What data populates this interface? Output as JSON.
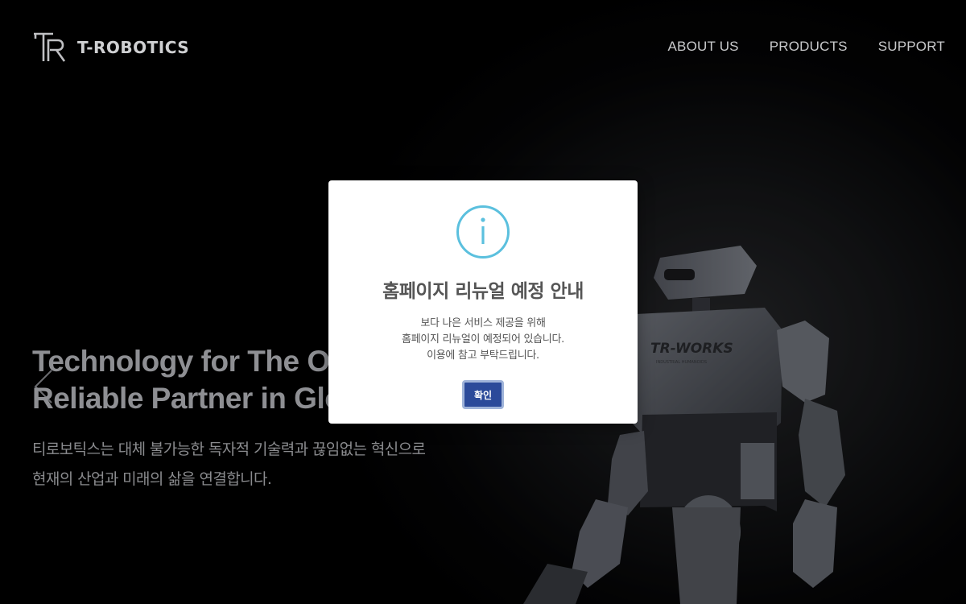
{
  "brand": {
    "name": "T-ROBOTICS",
    "logo_icon": "tr-logo-icon"
  },
  "nav": {
    "items": [
      "ABOUT US",
      "PRODUCTS",
      "SUPPORT"
    ]
  },
  "hero": {
    "title_line1": "Technology for The One",
    "title_line2": "Reliable Partner in Glob",
    "subtitle_line1": "티로보틱스는 대체 불가능한 독자적 기술력과 끊임없는 혁신으로",
    "subtitle_line2": "현재의 산업과 미래의 삶을 연결합니다.",
    "robot_label": "TR-WORKS",
    "robot_sublabel": "INDUSTRIAL HUMANOIDS",
    "prev_icon": "chevron-left-icon"
  },
  "modal": {
    "icon": "info-icon",
    "title": "홈페이지 리뉴얼 예정 안내",
    "body_line1": "보다 나은 서비스 제공을 위해",
    "body_line2": "홈페이지 리뉴얼이 예정되어 있습니다.",
    "body_line3": "이용에 참고 부탁드립니다.",
    "confirm_label": "확인",
    "accent_color": "#5bc0de",
    "button_color": "#2b4a9a"
  }
}
